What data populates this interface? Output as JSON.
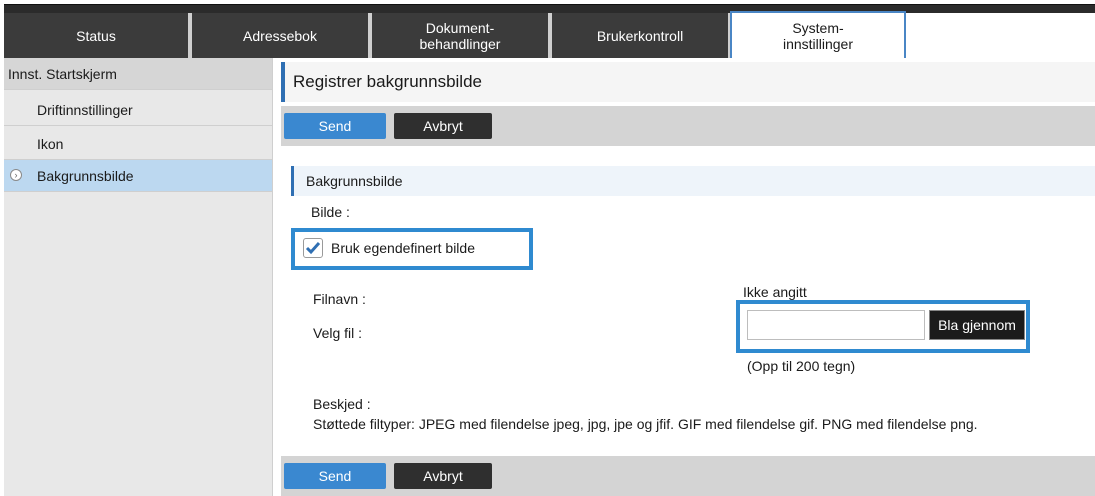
{
  "tabs": [
    {
      "label": "Status"
    },
    {
      "label": "Adressebok"
    },
    {
      "label": "Dokument-\nbehandlinger"
    },
    {
      "label": "Brukerkontroll"
    },
    {
      "label": "System-\ninnstillinger"
    }
  ],
  "sidebar": {
    "items": [
      {
        "label": "Innst. Startskjerm"
      },
      {
        "label": "Driftinnstillinger"
      },
      {
        "label": "Ikon"
      },
      {
        "label": "Bakgrunnsbilde"
      }
    ]
  },
  "page": {
    "title": "Registrer bakgrunnsbilde"
  },
  "buttons": {
    "send": "Send",
    "cancel": "Avbryt",
    "browse": "Bla gjennom"
  },
  "section": {
    "title": "Bakgrunnsbilde",
    "image_label": "Bilde :",
    "use_custom_label": "Bruk egendefinert bilde",
    "use_custom_checked": true,
    "filename_label": "Filnavn :",
    "filename_value": "Ikke angitt",
    "select_file_label": "Velg fil :",
    "file_input_value": "",
    "limit_hint": "(Opp til 200 tegn)",
    "message_label": "Beskjed :",
    "message_text": "Støttede filtyper: JPEG med filendelse jpeg, jpg, jpe og jfif. GIF med filendelse gif. PNG med filendelse png."
  },
  "colors": {
    "accent": "#2f6fb3",
    "highlight": "#2f8ad0",
    "send_button": "#3a88d0",
    "selected_row": "#bcd8f0"
  }
}
